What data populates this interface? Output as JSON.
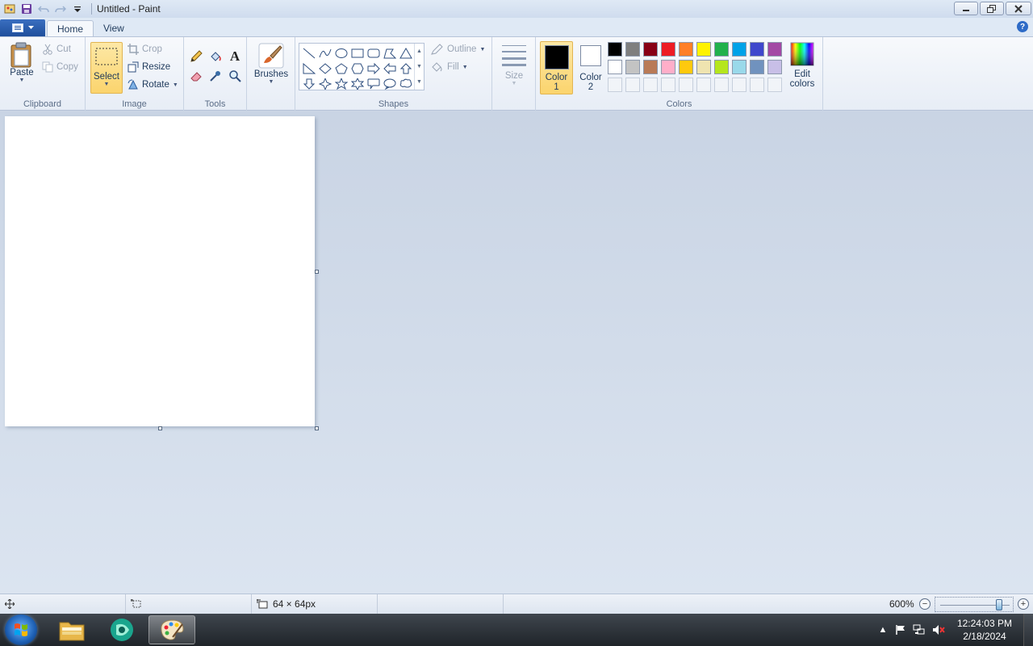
{
  "window": {
    "title": "Untitled - Paint"
  },
  "tabs": [
    {
      "label": "Home"
    },
    {
      "label": "View"
    }
  ],
  "help": {
    "label": "?"
  },
  "clipboard": {
    "paste": "Paste",
    "cut": "Cut",
    "copy": "Copy",
    "group": "Clipboard"
  },
  "image": {
    "select": "Select",
    "crop": "Crop",
    "resize": "Resize",
    "rotate": "Rotate",
    "group": "Image"
  },
  "tools": {
    "group": "Tools",
    "text_glyph": "A"
  },
  "brushes": {
    "label": "Brushes"
  },
  "shapes": {
    "outline": "Outline",
    "fill": "Fill",
    "group": "Shapes"
  },
  "size": {
    "label": "Size"
  },
  "colors": {
    "color1_line1": "Color",
    "color1_line2": "1",
    "color2_line1": "Color",
    "color2_line2": "2",
    "color1_value": "#000000",
    "color2_value": "#ffffff",
    "edit_line1": "Edit",
    "edit_line2": "colors",
    "group": "Colors",
    "palette_row1": [
      "#000000",
      "#7f7f7f",
      "#880015",
      "#ed1c24",
      "#ff7f27",
      "#fff200",
      "#22b14c",
      "#00a2e8",
      "#3f48cc",
      "#a349a4"
    ],
    "palette_row2": [
      "#ffffff",
      "#c3c3c3",
      "#b97a57",
      "#ffaec9",
      "#ffc90e",
      "#efe4b0",
      "#b5e61d",
      "#99d9ea",
      "#7092be",
      "#c8bfe7"
    ]
  },
  "status": {
    "canvas_size": "64 × 64px",
    "zoom": "600%",
    "zoom_fraction": 0.85
  },
  "clock": {
    "time": "12:24:03 PM",
    "date": "2/18/2024"
  }
}
